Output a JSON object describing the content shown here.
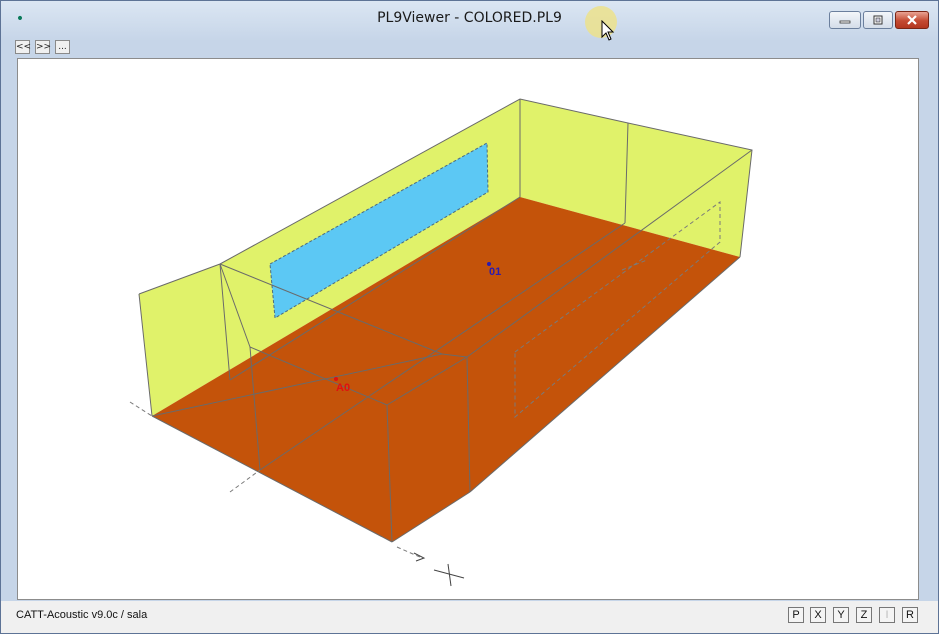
{
  "window": {
    "title": "PL9Viewer - COLORED.PL9",
    "controls": {
      "minimize_icon": "minimize-icon",
      "maximize_icon": "maximize-icon",
      "close_icon": "close-icon"
    }
  },
  "toolbar": {
    "prev_label": "<<",
    "next_label": ">>",
    "more_label": "..."
  },
  "viewport": {
    "points": [
      {
        "label": "01",
        "color": "#2a1bb0"
      },
      {
        "label": "A0",
        "color": "#e01010"
      }
    ],
    "colors": {
      "floor": "#c4530a",
      "walls": "#e0f26a",
      "window_panel": "#5cc8f4",
      "edges": "#606060"
    }
  },
  "statusbar": {
    "text": "CATT-Acoustic v9.0c / sala",
    "axis_buttons": [
      "P",
      "X",
      "Y",
      "Z",
      "I",
      "R"
    ]
  }
}
